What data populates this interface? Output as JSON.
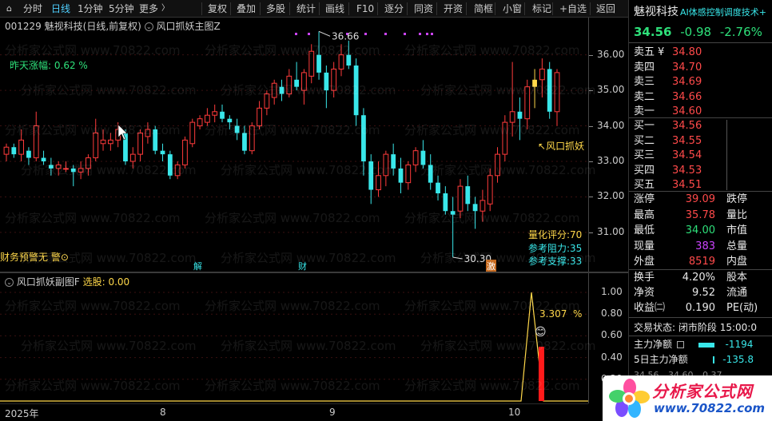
{
  "toolbar": {
    "items": [
      "分时",
      "日线",
      "1分钟",
      "5分钟",
      "更多",
      "复权",
      "叠加",
      "多股",
      "统计",
      "画线",
      "F10",
      "逐分",
      "同资",
      "开资",
      "简框",
      "小窗",
      "标记",
      "+自选",
      "返回"
    ],
    "active_index": 1,
    "more_arrow": "〉"
  },
  "main_chart": {
    "stock_code": "001229",
    "stock_name": "魅视科技",
    "period": "(日线,前复权)",
    "indicator_name": "风口抓妖主图Z",
    "prev_change_label": "昨天涨幅:",
    "prev_change_value": "0.62 %",
    "high_marker": "36.66",
    "low_marker": "30.30",
    "signal_label": "风口抓妖",
    "left_warning": "财务预警无 警⊙",
    "quant_score_label": "量化评分:",
    "quant_score_value": "70",
    "resistance_label": "参考阻力:",
    "resistance_value": "35",
    "support_label": "参考支撑:",
    "support_value": "33",
    "event_markers": [
      "解",
      "财",
      "激"
    ],
    "price_axis": [
      "36.00",
      "35.00",
      "34.00",
      "33.00",
      "32.00",
      "31.00"
    ]
  },
  "sub_chart": {
    "indicator_name": "风口抓妖副图F",
    "select_label": "选股:",
    "select_value": "0.00",
    "percent_value": "3.307",
    "percent_unit": "%",
    "axis": [
      "1.00",
      "0.80",
      "0.60",
      "0.40",
      "0.20"
    ]
  },
  "time_axis": [
    "2025年",
    "8",
    "9",
    "10"
  ],
  "right_panel": {
    "name": "魅视科技",
    "scroll_text": "AI体感控制调度技术+",
    "price": "34.56",
    "change": "-0.98",
    "change_pct": "-2.76%",
    "asks": [
      {
        "label": "卖五",
        "price": "34.80",
        "extra": "¥"
      },
      {
        "label": "卖四",
        "price": "34.70"
      },
      {
        "label": "卖三",
        "price": "34.69"
      },
      {
        "label": "卖二",
        "price": "34.66"
      },
      {
        "label": "卖一",
        "price": "34.60"
      }
    ],
    "bids": [
      {
        "label": "买一",
        "price": "34.56"
      },
      {
        "label": "买二",
        "price": "34.55"
      },
      {
        "label": "买三",
        "price": "34.54"
      },
      {
        "label": "买四",
        "price": "34.53"
      },
      {
        "label": "买五",
        "price": "34.51"
      }
    ],
    "stats": [
      {
        "label": "涨停",
        "value": "39.09",
        "label2": "跌停",
        "color": "red"
      },
      {
        "label": "最高",
        "value": "35.78",
        "label2": "量比",
        "color": "red"
      },
      {
        "label": "最低",
        "value": "34.00",
        "label2": "市值",
        "color": "green"
      },
      {
        "label": "现量",
        "value": "383",
        "label2": "总量",
        "color": "purple"
      },
      {
        "label": "外盘",
        "value": "8519",
        "label2": "内盘",
        "color": "red"
      }
    ],
    "stats2": [
      {
        "label": "换手",
        "value": "4.20%",
        "label2": "股本"
      },
      {
        "label": "净资",
        "value": "9.52",
        "label2": "流通"
      },
      {
        "label": "收益㈡",
        "value": "0.190",
        "label2": "PE(动)"
      }
    ],
    "trade_status_label": "交易状态:",
    "trade_status_value": "闭市阶段 15:00:0",
    "main_flow_label": "主力净额",
    "main_flow_value": "-1194",
    "main_flow_5d_label": "5日主力净额",
    "main_flow_5d_value": "-135.8",
    "bottom_partial": [
      "34.56",
      "34.60",
      "0.37"
    ]
  },
  "logo": {
    "text": "分析家公式网",
    "url_text": "www.70822.com"
  },
  "watermark_text": "分析家公式网 www.70822.com",
  "chart_data": {
    "type": "candlestick",
    "title": "风口抓妖主图Z",
    "ylim": [
      30.0,
      37.0
    ],
    "high_label": 36.66,
    "low_label": 30.3,
    "candles": [
      [
        33.2,
        33.5,
        33.0,
        33.4
      ],
      [
        33.4,
        33.5,
        33.1,
        33.2
      ],
      [
        33.2,
        33.9,
        33.0,
        33.6
      ],
      [
        33.3,
        33.4,
        32.9,
        33.1
      ],
      [
        33.1,
        34.4,
        33.0,
        34.0
      ],
      [
        33.1,
        33.3,
        32.9,
        33.0
      ],
      [
        32.9,
        33.1,
        32.6,
        32.8
      ],
      [
        32.8,
        33.0,
        32.6,
        32.9
      ],
      [
        32.8,
        33.0,
        32.7,
        32.8
      ],
      [
        32.8,
        32.9,
        32.3,
        32.7
      ],
      [
        32.7,
        33.0,
        32.5,
        32.8
      ],
      [
        32.8,
        33.2,
        32.6,
        33.1
      ],
      [
        33.1,
        34.2,
        33.0,
        33.8
      ],
      [
        33.5,
        33.9,
        33.3,
        33.6
      ],
      [
        33.5,
        33.8,
        33.3,
        33.6
      ],
      [
        33.6,
        34.1,
        33.4,
        33.9
      ],
      [
        33.8,
        33.9,
        32.9,
        33.0
      ],
      [
        33.0,
        33.4,
        32.8,
        33.2
      ],
      [
        33.2,
        33.9,
        33.0,
        33.8
      ],
      [
        33.7,
        34.1,
        33.5,
        33.9
      ],
      [
        33.9,
        34.0,
        33.2,
        33.3
      ],
      [
        33.3,
        33.5,
        33.0,
        33.2
      ],
      [
        33.2,
        33.3,
        32.5,
        32.6
      ],
      [
        32.6,
        33.0,
        32.5,
        32.9
      ],
      [
        32.9,
        33.7,
        32.8,
        33.6
      ],
      [
        33.5,
        34.2,
        33.4,
        34.1
      ],
      [
        34.0,
        34.3,
        33.9,
        34.2
      ],
      [
        34.1,
        34.5,
        34.0,
        34.3
      ],
      [
        34.3,
        34.6,
        34.1,
        34.4
      ],
      [
        34.4,
        34.6,
        34.1,
        34.2
      ],
      [
        34.2,
        34.3,
        33.9,
        34.1
      ],
      [
        34.0,
        34.2,
        33.6,
        33.8
      ],
      [
        33.8,
        34.0,
        33.2,
        33.3
      ],
      [
        33.3,
        34.1,
        33.2,
        34.0
      ],
      [
        34.0,
        34.7,
        33.9,
        34.5
      ],
      [
        34.5,
        35.0,
        34.3,
        34.9
      ],
      [
        34.8,
        35.3,
        34.6,
        35.2
      ],
      [
        35.1,
        35.3,
        34.7,
        34.9
      ],
      [
        34.9,
        35.6,
        34.8,
        35.4
      ],
      [
        35.3,
        35.8,
        35.0,
        35.1
      ],
      [
        35.0,
        35.6,
        34.6,
        35.5
      ],
      [
        35.4,
        36.3,
        35.2,
        36.1
      ],
      [
        36.0,
        36.66,
        35.3,
        35.5
      ],
      [
        35.5,
        35.7,
        34.5,
        35.0
      ],
      [
        35.0,
        35.8,
        34.8,
        35.6
      ],
      [
        35.6,
        36.3,
        35.4,
        36.0
      ],
      [
        36.0,
        36.4,
        35.6,
        35.7
      ],
      [
        35.7,
        35.9,
        34.0,
        34.3
      ],
      [
        34.3,
        34.5,
        32.6,
        33.0
      ],
      [
        33.0,
        33.2,
        31.8,
        32.2
      ],
      [
        32.2,
        33.0,
        32.0,
        32.6
      ],
      [
        32.6,
        33.3,
        32.3,
        33.2
      ],
      [
        33.2,
        33.5,
        32.6,
        32.8
      ],
      [
        32.8,
        33.1,
        32.1,
        32.4
      ],
      [
        32.4,
        33.0,
        32.2,
        32.9
      ],
      [
        32.9,
        33.4,
        32.7,
        33.3
      ],
      [
        33.3,
        33.6,
        32.8,
        32.9
      ],
      [
        32.9,
        33.2,
        32.2,
        32.4
      ],
      [
        32.4,
        32.6,
        31.9,
        32.1
      ],
      [
        32.1,
        32.3,
        31.5,
        31.6
      ],
      [
        31.6,
        32.0,
        30.3,
        31.5
      ],
      [
        31.6,
        32.5,
        31.4,
        32.3
      ],
      [
        32.3,
        32.6,
        31.6,
        31.8
      ],
      [
        31.8,
        32.0,
        31.1,
        31.6
      ],
      [
        31.6,
        32.2,
        31.3,
        31.9
      ],
      [
        31.8,
        32.8,
        31.6,
        32.6
      ],
      [
        32.6,
        33.4,
        32.4,
        33.2
      ],
      [
        33.2,
        34.3,
        33.0,
        34.1
      ],
      [
        34.1,
        35.8,
        33.7,
        34.4
      ],
      [
        34.4,
        34.8,
        33.6,
        34.2
      ],
      [
        34.2,
        35.3,
        33.9,
        35.1
      ],
      [
        35.1,
        35.6,
        34.5,
        35.3
      ],
      [
        35.3,
        35.9,
        34.8,
        35.6
      ],
      [
        35.6,
        35.8,
        34.2,
        34.4
      ],
      [
        34.4,
        35.6,
        34.0,
        35.5
      ]
    ],
    "signal_candle_index": 71,
    "sub_indicator": {
      "type": "line",
      "ylim": [
        0,
        1.05
      ],
      "line_peak_value": 1.0,
      "bar_value": 0.5
    }
  }
}
